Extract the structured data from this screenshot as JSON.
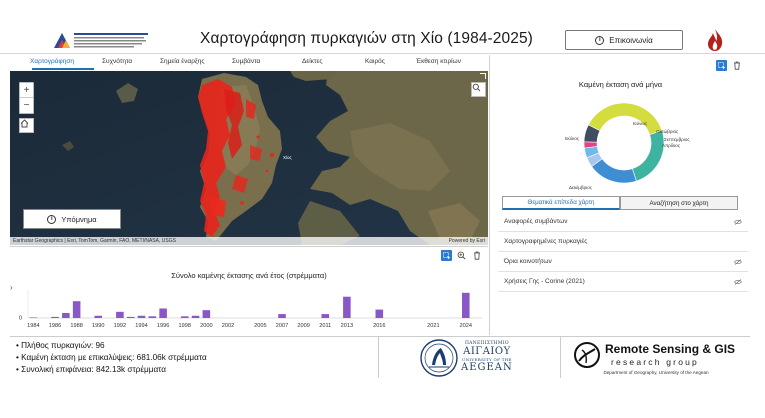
{
  "header": {
    "title": "Χαρτογράφηση πυρκαγιών στη Χίο (1984-2025)",
    "contact_label": "Επικοινωνία"
  },
  "tabs": [
    {
      "label": "Χαρτογράφηση",
      "active": true
    },
    {
      "label": "Συχνότητα",
      "active": false
    },
    {
      "label": "Σημεία έναρξης",
      "active": false
    },
    {
      "label": "Συμβάντα",
      "active": false
    },
    {
      "label": "Δείκτες",
      "active": false
    },
    {
      "label": "Καιρός",
      "active": false
    },
    {
      "label": "Έκθεση κτιρίων",
      "active": false
    }
  ],
  "map": {
    "legend_label": "Υπόμνημα",
    "attribution": "Earthstar Geographics | Esri, TomTom, Garmin, FAO, METI/NASA, USGS",
    "powered_by": "Powered by Esri",
    "place_label": "Χίος"
  },
  "bar_chart": {
    "title": "Σύνολο καμένης έκτασης ανά έτος (στρέμματα)",
    "chart_data": {
      "type": "bar",
      "title": "Σύνολο καμένης έκτασης ανά έτος (στρέμματα)",
      "ytick_labels": [
        "0"
      ],
      "xtick_labels": [
        "1984",
        "1986",
        "1988",
        "1990",
        "1992",
        "1994",
        "1996",
        "1998",
        "2000",
        "2002",
        "2005",
        "2007",
        "2009",
        "2011",
        "2013",
        "2016",
        "2021",
        "2024"
      ],
      "categories": [
        1984,
        1985,
        1986,
        1987,
        1988,
        1989,
        1990,
        1991,
        1992,
        1993,
        1994,
        1995,
        1996,
        1997,
        1998,
        1999,
        2000,
        2001,
        2002,
        2003,
        2004,
        2005,
        2006,
        2007,
        2008,
        2009,
        2010,
        2011,
        2012,
        2013,
        2014,
        2015,
        2016,
        2017,
        2018,
        2019,
        2020,
        2021,
        2022,
        2023,
        2024,
        2025
      ],
      "values": [
        2,
        0,
        4,
        18,
        60,
        0,
        8,
        0,
        22,
        4,
        8,
        6,
        34,
        0,
        6,
        8,
        28,
        0,
        0,
        0,
        0,
        0,
        0,
        14,
        0,
        0,
        0,
        14,
        0,
        76,
        0,
        0,
        30,
        0,
        0,
        0,
        0,
        0,
        0,
        0,
        90,
        0
      ],
      "ylim": [
        0,
        100
      ],
      "color": "#8a57c9"
    }
  },
  "donut_chart": {
    "title": "Καμένη έκταση ανά μήνα",
    "chart_data": {
      "type": "pie",
      "title": "Καμένη έκταση ανά μήνα",
      "categories": [
        "Ιούλιος",
        "Αύγουστος",
        "Δεκέμβριος",
        "Απρίλιος",
        "Σεπτέμβριος",
        "Οκτώβριος",
        "Ιούνιος"
      ],
      "values": [
        37.5,
        25,
        20,
        4,
        4,
        2.5,
        7
      ],
      "colors": [
        "#d4dd3f",
        "#3eb3a0",
        "#3f8ed4",
        "#a7c7ef",
        "#6fbbe8",
        "#e0458a",
        "#3f4e62"
      ]
    }
  },
  "right_tabs": [
    {
      "label": "Θεματικά επίπεδα χάρτη",
      "active": true
    },
    {
      "label": "Αναζήτηση στο χάρτη",
      "active": false
    }
  ],
  "layers": [
    {
      "label": "Αναφορές συμβάντων",
      "eye": true
    },
    {
      "label": "Χαρτογραφημένες πυρκαγιές",
      "eye": false
    },
    {
      "label": "Όρια κοινοτήτων",
      "eye": true
    },
    {
      "label": "Χρήσεις Γης - Corine (2021)",
      "eye": true
    }
  ],
  "stats": [
    "• Πλήθος πυρκαγιών: 96",
    "• Καμένη έκταση με επικαλύψεις: 681.06k στρέμματα",
    "• Συνολική επιφάνεια: 842.13k στρέμματα"
  ],
  "university": {
    "line1": "ΠΑΝΕΠΙΣΤΗΜΙΟ",
    "line2": "ΑΙΓΑΙΟΥ",
    "line3": "UNIVERSITY OF THE",
    "line4": "AEGEAN"
  },
  "research_group": {
    "title": "Remote Sensing & GIS",
    "subtitle": "research group",
    "department": "Department of Geography, University of the Aegean"
  },
  "colors": {
    "accent": "#1f6fb5",
    "bars": "#8a57c9",
    "burn": "#e8241c"
  }
}
